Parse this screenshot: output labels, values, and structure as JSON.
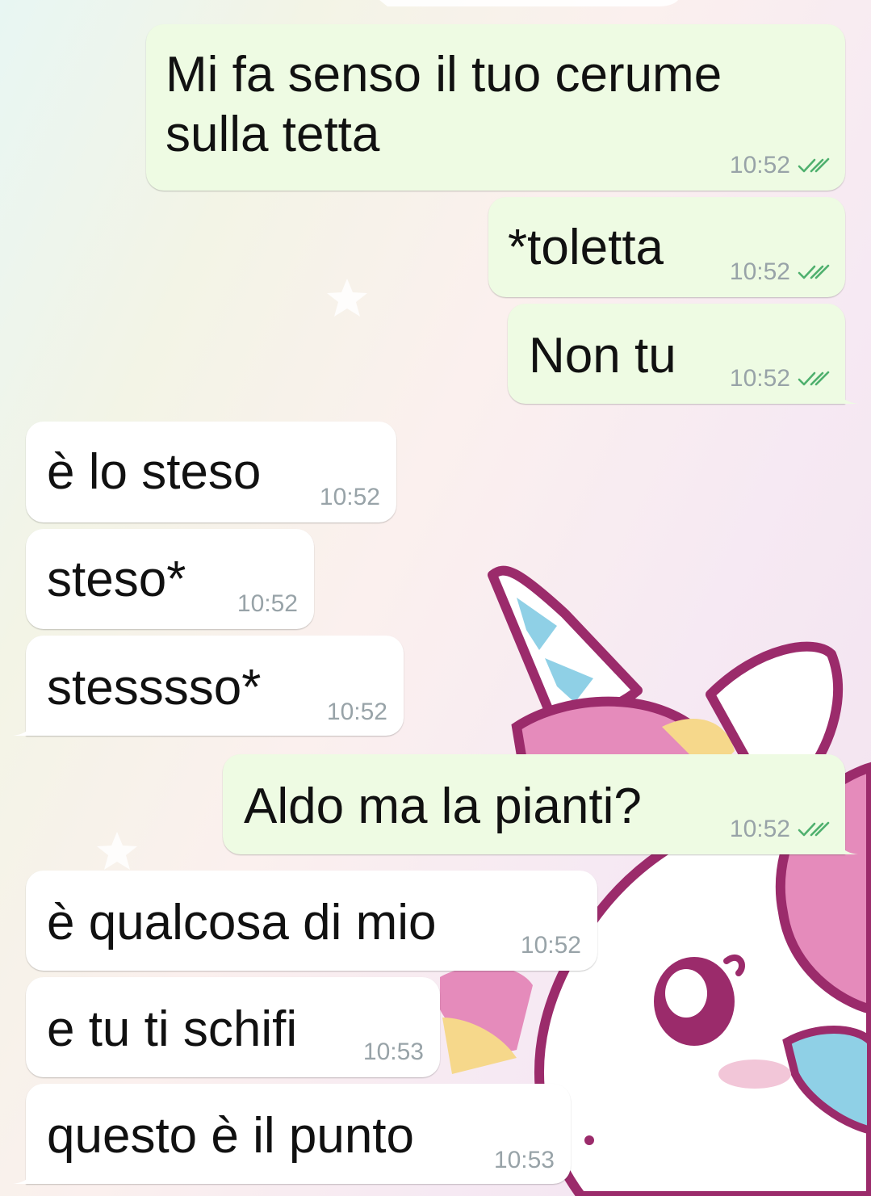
{
  "theme": {
    "outgoing_bg": "#eefbe3",
    "incoming_bg": "#ffffff",
    "read_tick_color": "#4fb06e",
    "timestamp_color": "#98a3a8"
  },
  "messages": [
    {
      "direction": "outgoing",
      "text_lines": [
        "Mi fa senso il tuo cerume",
        "sulla tetta"
      ],
      "time": "10:52",
      "status_icon": "double-check-icon"
    },
    {
      "direction": "outgoing",
      "text": "*toletta",
      "time": "10:52",
      "status_icon": "double-check-icon"
    },
    {
      "direction": "outgoing",
      "text": "Non tu",
      "time": "10:52",
      "status_icon": "double-check-icon"
    },
    {
      "direction": "incoming",
      "text": "è lo steso",
      "time": "10:52"
    },
    {
      "direction": "incoming",
      "text": "steso*",
      "time": "10:52"
    },
    {
      "direction": "incoming",
      "text": "stesssso*",
      "time": "10:52"
    },
    {
      "direction": "outgoing",
      "text": "Aldo ma la pianti?",
      "time": "10:52",
      "status_icon": "double-check-icon"
    },
    {
      "direction": "incoming",
      "text": "è qualcosa di mio",
      "time": "10:52"
    },
    {
      "direction": "incoming",
      "text": "e tu ti schifi",
      "time": "10:53"
    },
    {
      "direction": "incoming",
      "text": "questo è il punto",
      "time": "10:53"
    }
  ],
  "wallpaper": {
    "motif": "unicorn-illustration"
  }
}
